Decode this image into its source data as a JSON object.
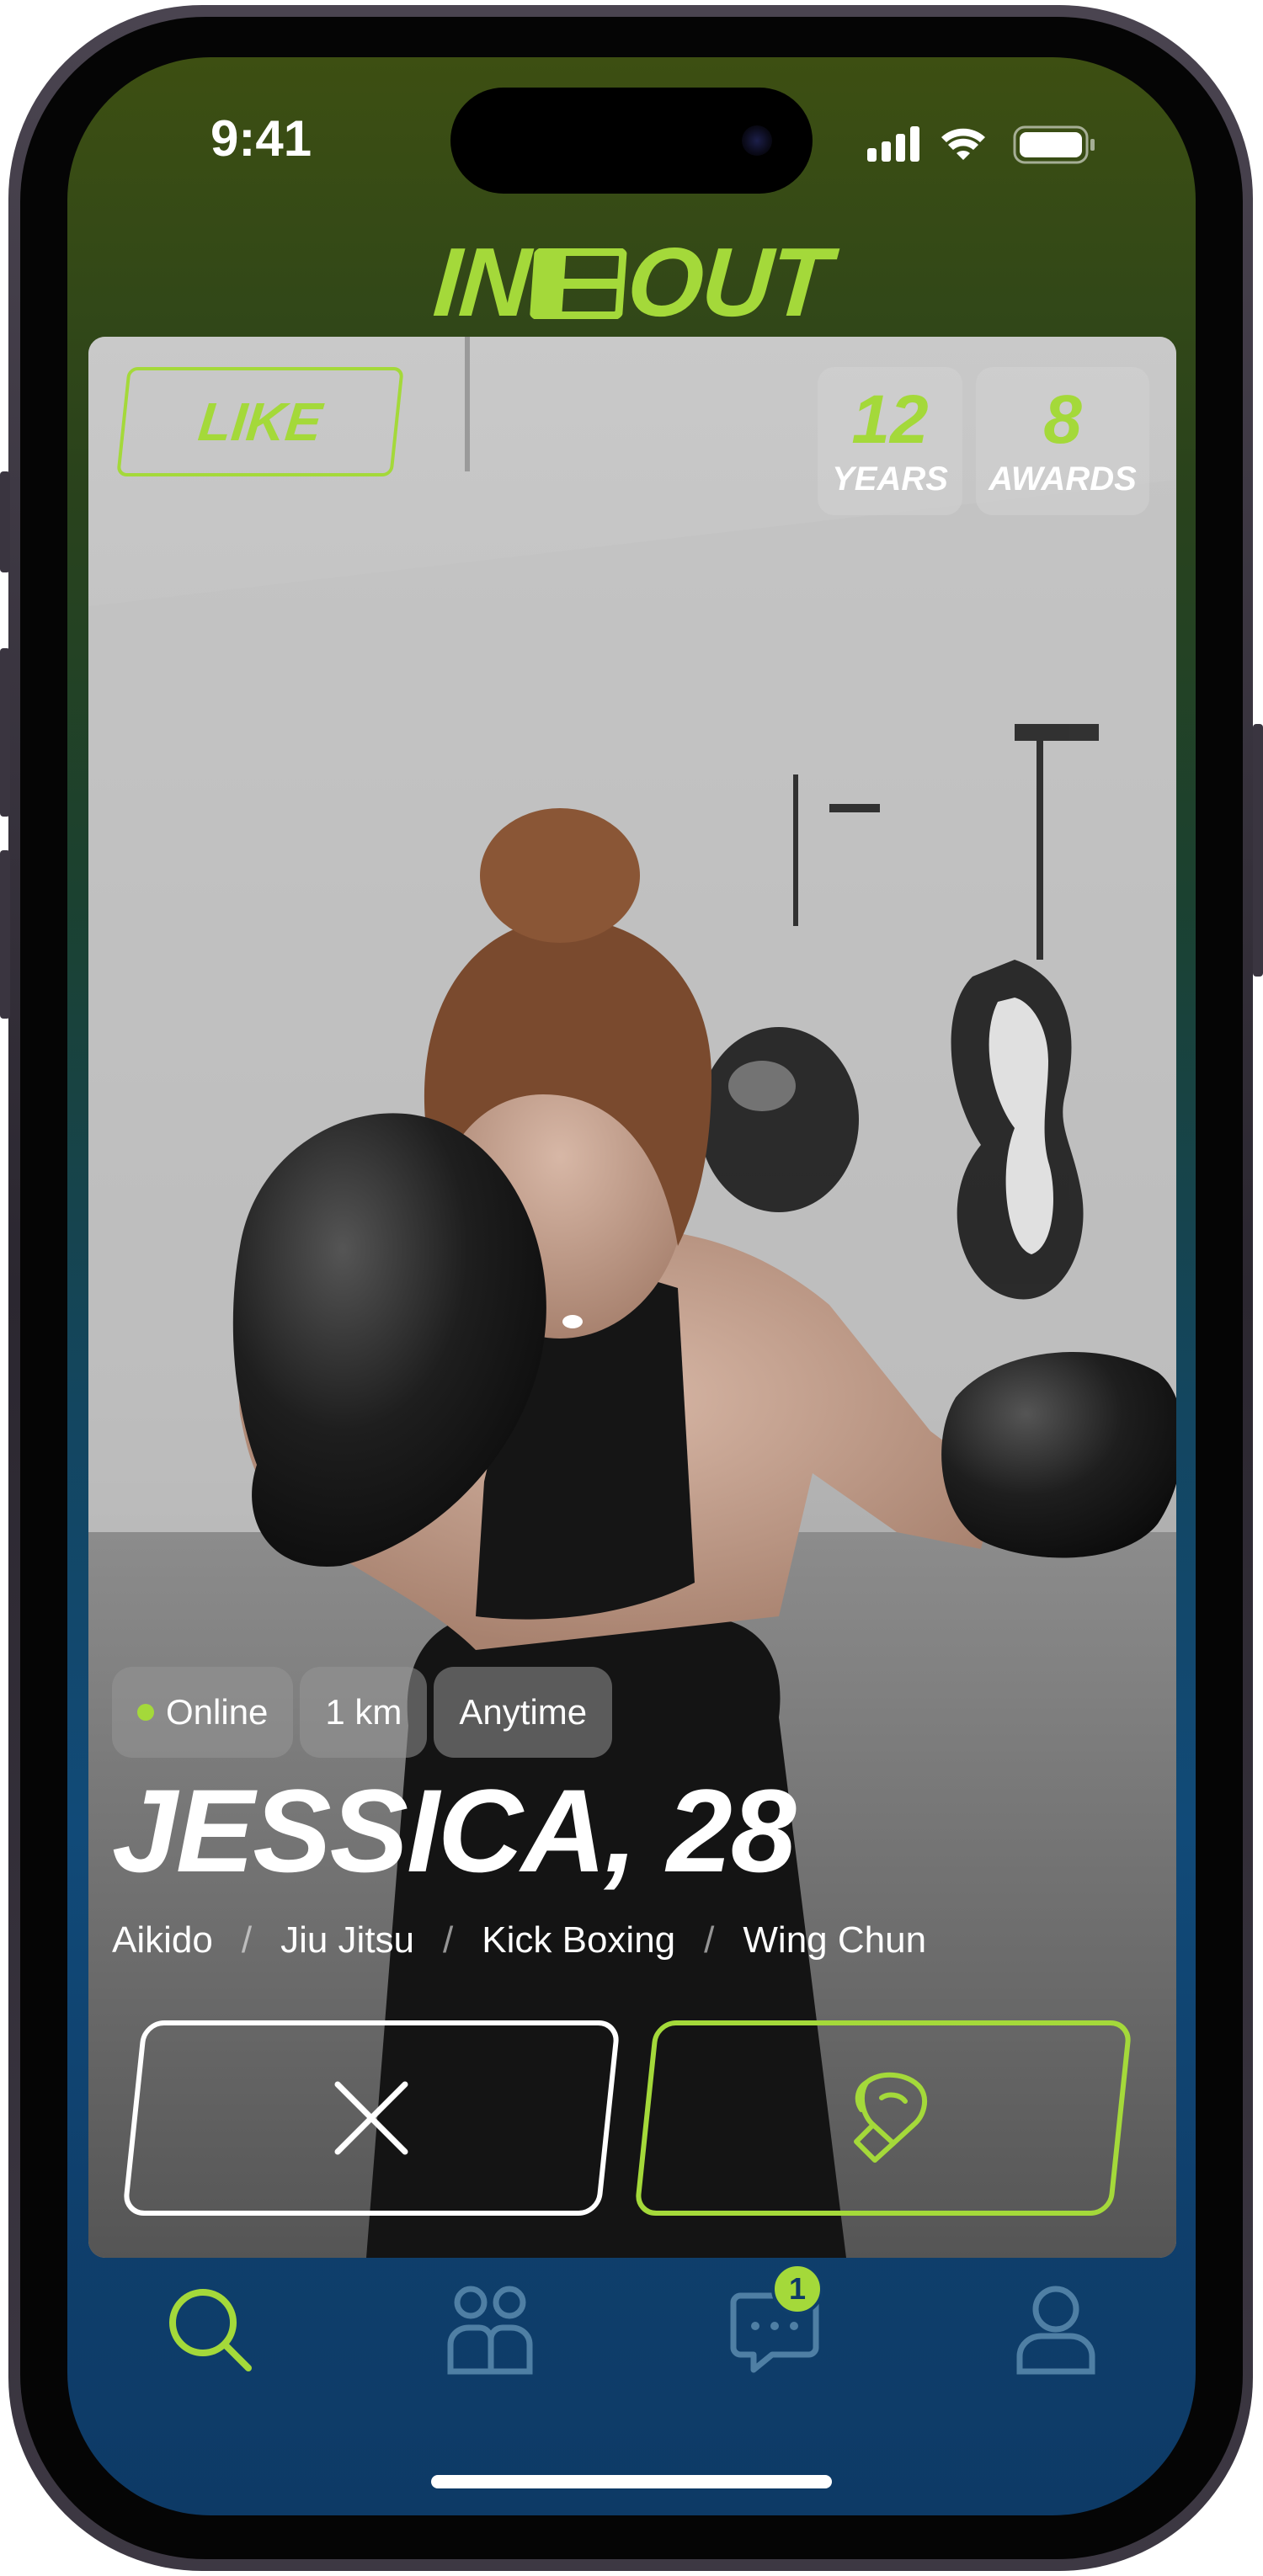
{
  "status_bar": {
    "time": "9:41"
  },
  "app": {
    "logo_left": "IN",
    "logo_right": "OUT",
    "accent": "#a4d93a"
  },
  "profile": {
    "like_stamp": "LIKE",
    "stats": [
      {
        "value": "12",
        "label": "YEARS"
      },
      {
        "value": "8",
        "label": "AWARDS"
      }
    ],
    "chips": [
      {
        "label": "Online",
        "status": "online"
      },
      {
        "label": "1 km"
      },
      {
        "label": "Anytime"
      }
    ],
    "name": "JESSICA, 28",
    "disciplines": [
      "Aikido",
      "Jiu Jitsu",
      "Kick Boxing",
      "Wing Chun"
    ]
  },
  "actions": {
    "pass": "close-icon",
    "like": "boxing-glove-icon"
  },
  "tab_bar": {
    "items": [
      {
        "name": "search",
        "icon": "search-icon",
        "active": true
      },
      {
        "name": "community",
        "icon": "people-icon",
        "active": false
      },
      {
        "name": "messages",
        "icon": "chat-icon",
        "active": false,
        "badge": "1"
      },
      {
        "name": "profile",
        "icon": "user-icon",
        "active": false
      }
    ]
  }
}
